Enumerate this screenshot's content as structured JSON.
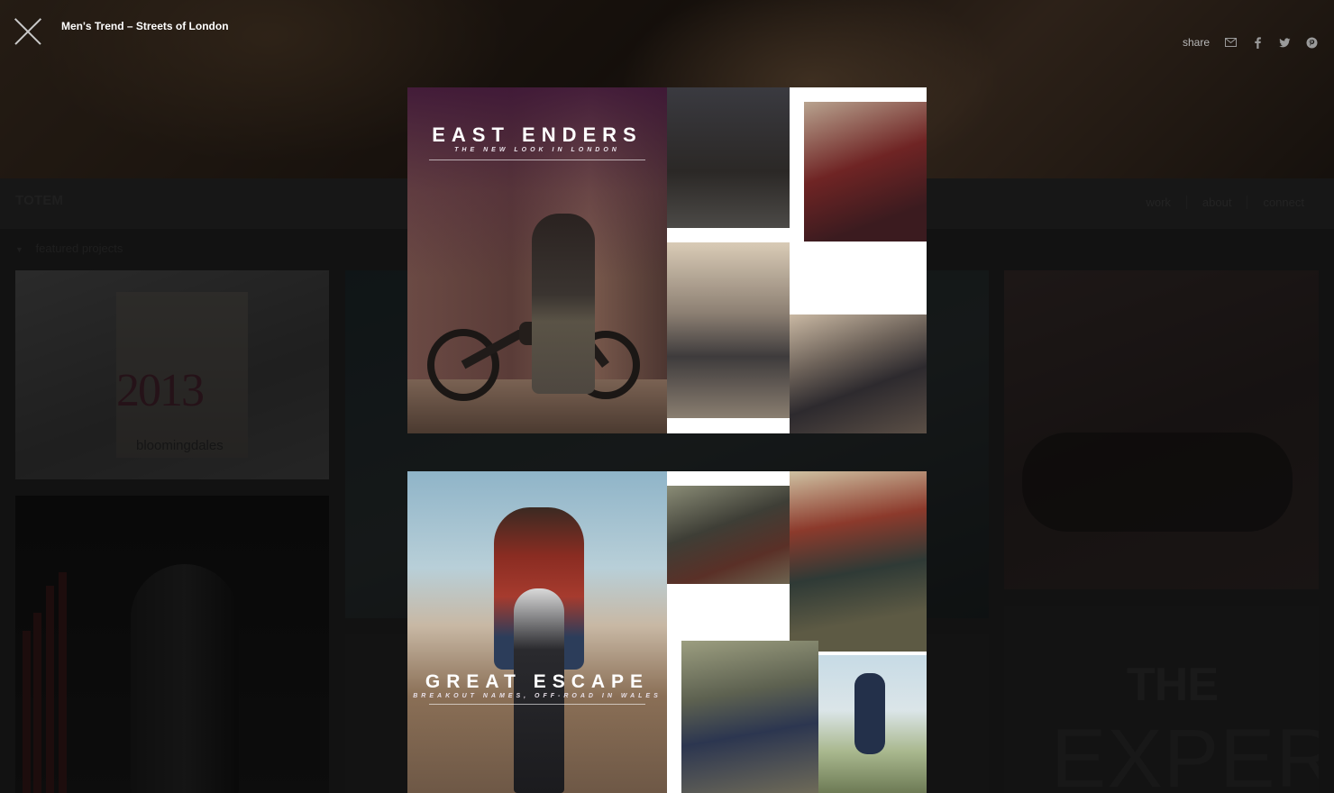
{
  "lightbox": {
    "title": "Men's Trend – Streets of London",
    "share_label": "share",
    "share_icons": [
      "mail-icon",
      "facebook-icon",
      "twitter-icon",
      "pinterest-icon"
    ],
    "spread1": {
      "title": "EAST ENDERS",
      "subtitle": "THE NEW LOOK IN LONDON"
    },
    "spread2": {
      "title": "GREAT ESCAPE",
      "subtitle": "BREAKOUT NAMES, OFF-ROAD IN WALES"
    }
  },
  "site": {
    "logo": "TOTEM",
    "nav": [
      "work",
      "about",
      "connect"
    ],
    "section_label": "featured projects",
    "tiles": {
      "catalog_year": "2013",
      "catalog_brand": "bloomingdales",
      "tile6_line1": "THE",
      "tile6_line2": "EXPERI"
    }
  },
  "colors": {
    "overlay": "#000000",
    "lightbox_text": "#ffffff",
    "share_icon": "#9a9a9a",
    "dim_text": "#474747"
  }
}
